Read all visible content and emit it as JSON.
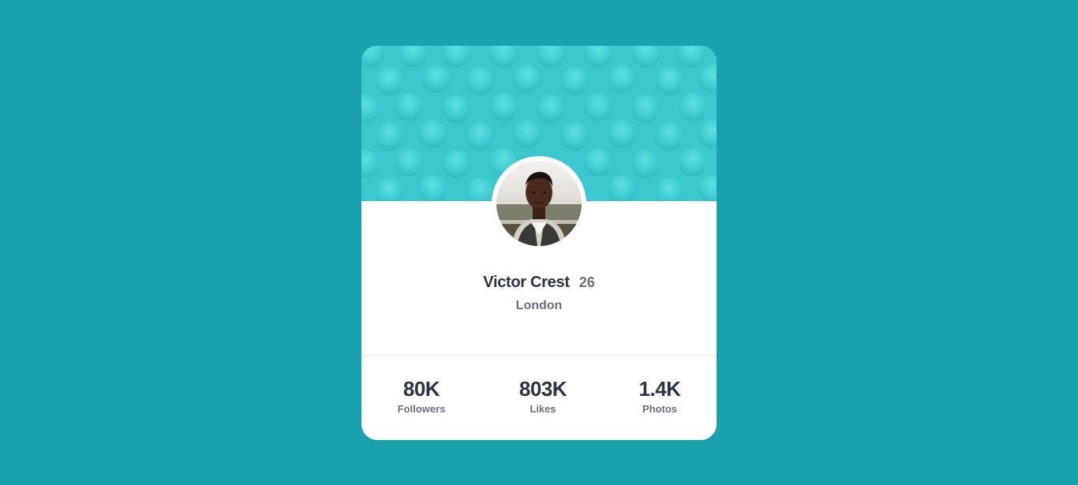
{
  "colors": {
    "page_background": "#19a2ae",
    "card_background": "#ffffff",
    "banner_teal": "#3cc8cf",
    "primary_text": "#2e3246",
    "secondary_text": "#6b7082"
  },
  "profile": {
    "name": "Victor Crest",
    "age": "26",
    "location": "London",
    "avatar_icon": "user-photo"
  },
  "stats": [
    {
      "value": "80K",
      "label": "Followers"
    },
    {
      "value": "803K",
      "label": "Likes"
    },
    {
      "value": "1.4K",
      "label": "Photos"
    }
  ]
}
